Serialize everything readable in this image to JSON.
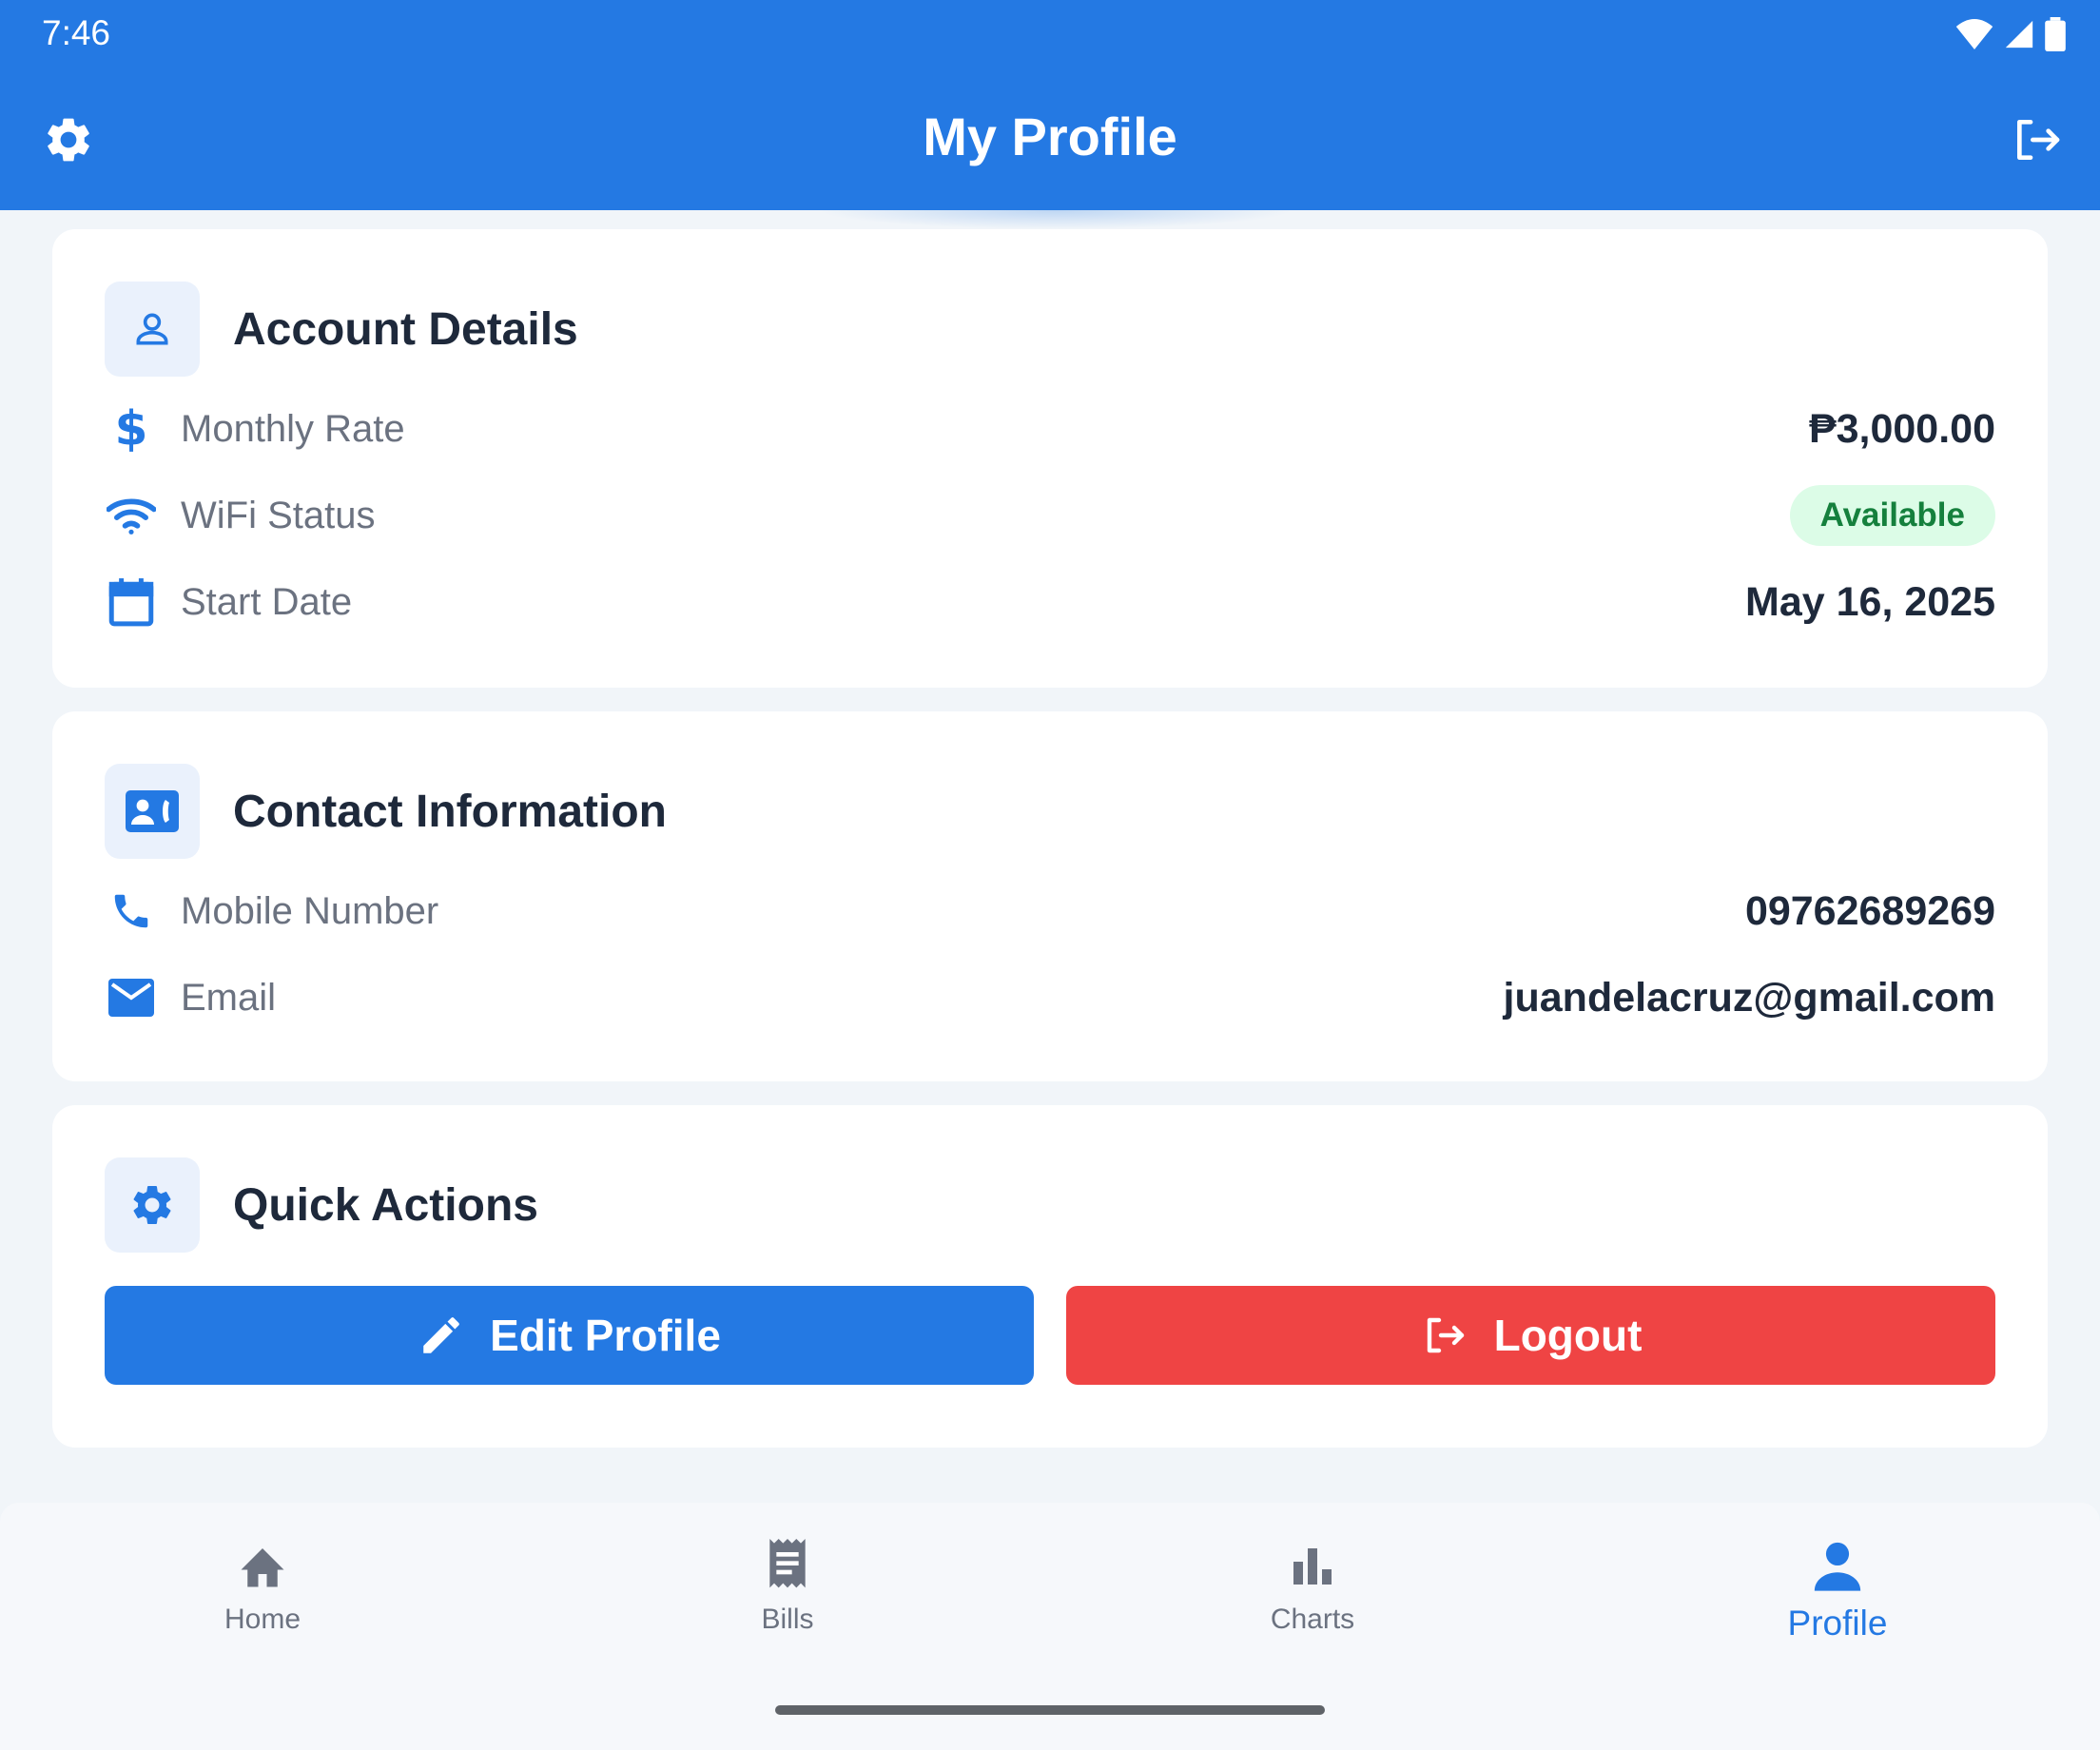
{
  "status_bar": {
    "time": "7:46"
  },
  "appbar": {
    "title": "My Profile"
  },
  "account": {
    "title": "Account Details",
    "rows": [
      {
        "label": "Monthly Rate",
        "value": "₱3,000.00"
      },
      {
        "label": "WiFi Status",
        "value": "Available"
      },
      {
        "label": "Start Date",
        "value": "May 16, 2025"
      }
    ]
  },
  "contact": {
    "title": "Contact Information",
    "rows": [
      {
        "label": "Mobile Number",
        "value": "09762689269"
      },
      {
        "label": "Email",
        "value": "juandelacruz@gmail.com"
      }
    ]
  },
  "actions": {
    "title": "Quick Actions",
    "edit_label": "Edit Profile",
    "logout_label": "Logout"
  },
  "nav": {
    "items": [
      {
        "label": "Home"
      },
      {
        "label": "Bills"
      },
      {
        "label": "Charts"
      },
      {
        "label": "Profile"
      }
    ]
  },
  "colors": {
    "primary": "#2479E3",
    "danger": "#EF4444",
    "success_bg": "#DCFCE7",
    "success_text": "#15803D"
  }
}
